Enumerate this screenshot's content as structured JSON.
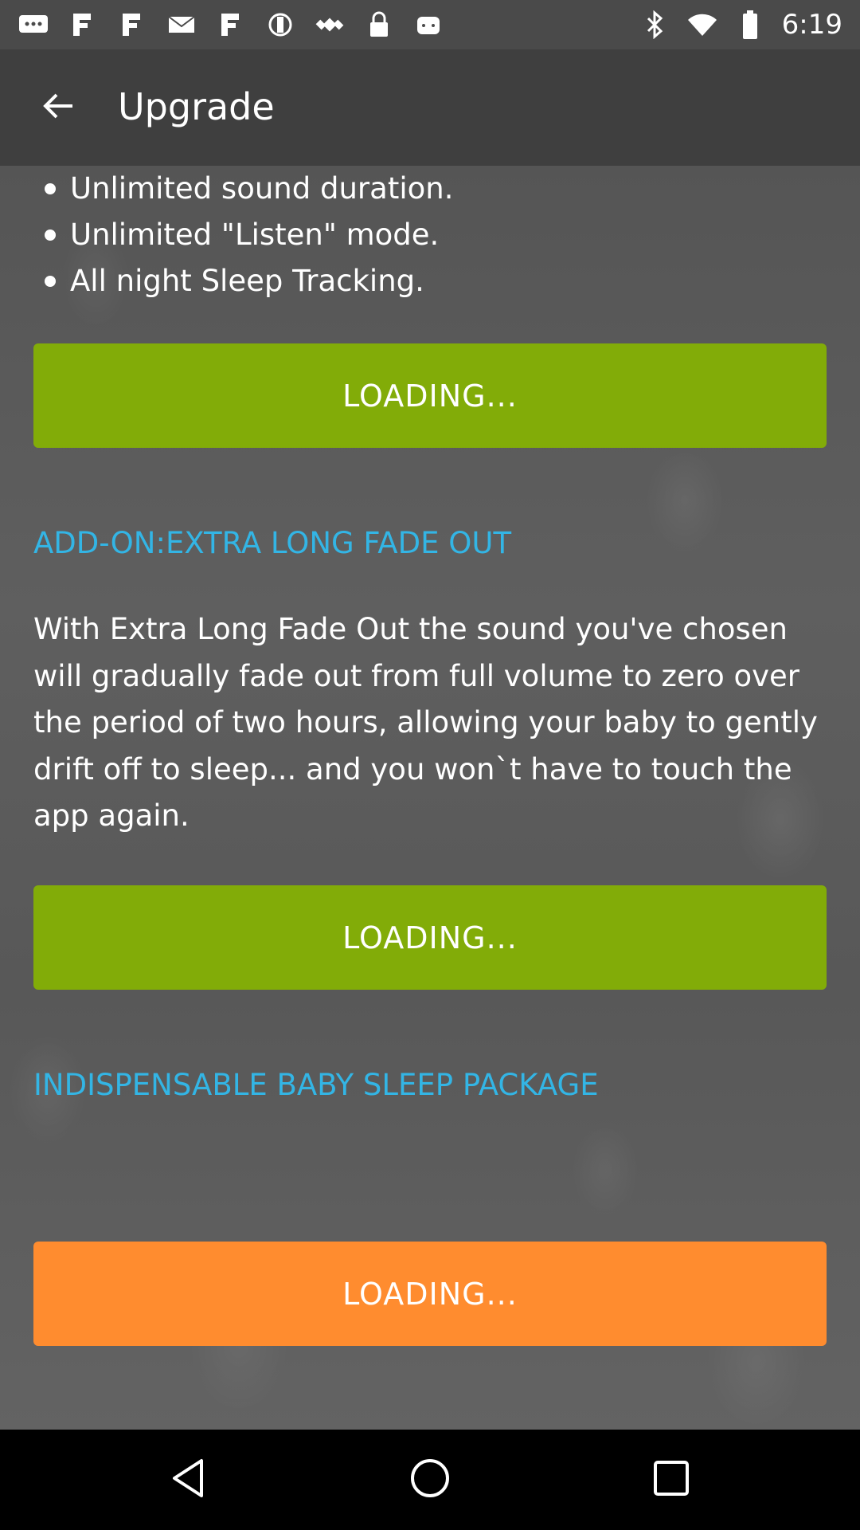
{
  "status_bar": {
    "time": "6:19",
    "left_icons": [
      "messaging-icon",
      "notification-icon",
      "notification-icon",
      "mail-icon",
      "notification-icon",
      "do-not-disturb-icon",
      "fake-gps-icon",
      "lock-icon",
      "android-icon"
    ],
    "right_icons": [
      "bluetooth-icon",
      "wifi-icon",
      "battery-icon"
    ]
  },
  "app_bar": {
    "title": "Upgrade"
  },
  "features": [
    "Unlimited sound duration.",
    "Unlimited \"Listen\" mode.",
    "All night Sleep Tracking."
  ],
  "buttons": {
    "upgrade_loading": "LOADING...",
    "addon_loading": "LOADING...",
    "package_loading": "LOADING..."
  },
  "addon": {
    "title": "ADD-ON:EXTRA LONG FADE OUT",
    "description": "With Extra Long Fade Out the sound you've chosen will gradually fade out from full volume to zero over the period of two hours, allowing your baby to gently drift off to sleep... and you won`t have to touch the app again."
  },
  "package": {
    "title": "INDISPENSABLE BABY SLEEP PACKAGE"
  },
  "colors": {
    "accent_green": "#82ac08",
    "accent_orange": "#ff8c2f",
    "section_title_blue": "#33b5e5",
    "app_bar": "#3f3f3f"
  },
  "nav_bar": {
    "icons": [
      "back-triangle-icon",
      "home-circle-icon",
      "recents-square-icon"
    ]
  }
}
